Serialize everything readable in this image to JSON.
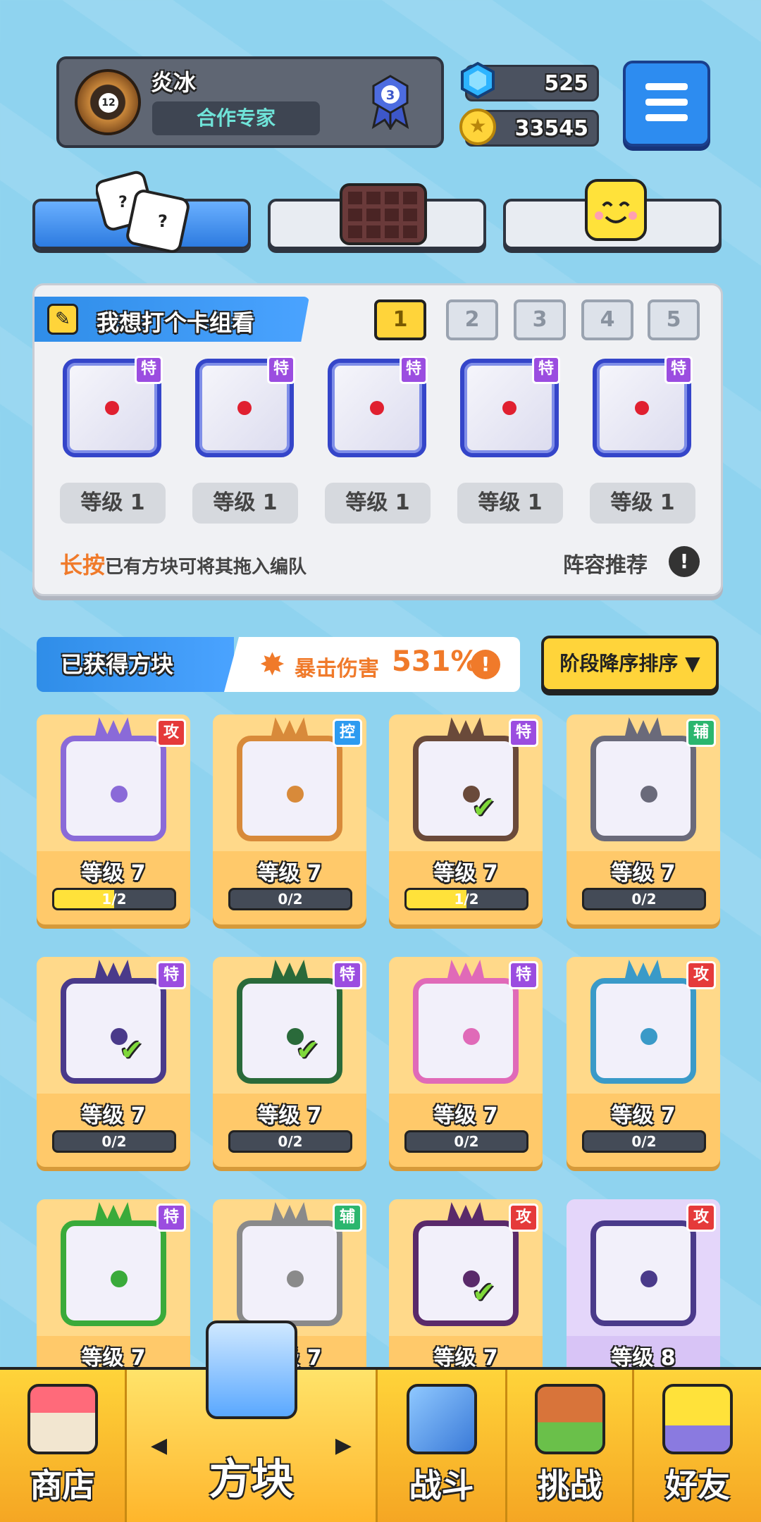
{
  "player": {
    "name": "炎冰",
    "title": "合作专家",
    "avatar_level": "12",
    "rank": "3"
  },
  "currency": {
    "gems": "525",
    "coins": "33545"
  },
  "deck": {
    "title": "我想打个卡组看",
    "numbers": [
      "1",
      "2",
      "3",
      "4",
      "5"
    ],
    "active_index": 0,
    "slots": [
      {
        "tag": "特",
        "level": "等级 1"
      },
      {
        "tag": "特",
        "level": "等级 1"
      },
      {
        "tag": "特",
        "level": "等级 1"
      },
      {
        "tag": "特",
        "level": "等级 1"
      },
      {
        "tag": "特",
        "level": "等级 1"
      }
    ],
    "hint_emph": "长按",
    "hint_rest": "已有方块可将其拖入编队",
    "recommend": "阵容推荐",
    "recommend_icon": "!"
  },
  "collection": {
    "title": "已获得方块",
    "crit_label": "暴击伤害",
    "crit_value": "531%",
    "crit_icon": "!",
    "sort_label": "阶段降序排序 ▼",
    "cards": [
      {
        "tag": "攻",
        "tag_type": "gong",
        "level": "等级 7",
        "progress": "1/2",
        "fill": 0.5,
        "color": "#8a6ad8",
        "checked": false
      },
      {
        "tag": "控",
        "tag_type": "kong",
        "level": "等级 7",
        "progress": "0/2",
        "fill": 0,
        "color": "#d88a3a",
        "checked": false
      },
      {
        "tag": "特",
        "tag_type": "te",
        "level": "等级 7",
        "progress": "1/2",
        "fill": 0.5,
        "color": "#6a4a3a",
        "checked": true
      },
      {
        "tag": "辅",
        "tag_type": "fu",
        "level": "等级 7",
        "progress": "0/2",
        "fill": 0,
        "color": "#6a6a7a",
        "checked": false
      },
      {
        "tag": "特",
        "tag_type": "te",
        "level": "等级 7",
        "progress": "0/2",
        "fill": 0,
        "color": "#4a3a8a",
        "checked": true
      },
      {
        "tag": "特",
        "tag_type": "te",
        "level": "等级 7",
        "progress": "0/2",
        "fill": 0,
        "color": "#2a6a3a",
        "checked": true
      },
      {
        "tag": "特",
        "tag_type": "te",
        "level": "等级 7",
        "progress": "0/2",
        "fill": 0,
        "color": "#e06ab8",
        "checked": false
      },
      {
        "tag": "攻",
        "tag_type": "gong",
        "level": "等级 7",
        "progress": "0/2",
        "fill": 0,
        "color": "#3a9ac8",
        "checked": false
      },
      {
        "tag": "特",
        "tag_type": "te",
        "level": "等级 7",
        "color": "#3aaa3a",
        "checked": false
      },
      {
        "tag": "辅",
        "tag_type": "fu",
        "level": "等级 7",
        "color": "#8a8a8a",
        "checked": false
      },
      {
        "tag": "攻",
        "tag_type": "gong",
        "level": "等级 7",
        "color": "#5a2a6a",
        "checked": true
      },
      {
        "tag": "攻",
        "tag_type": "gong",
        "level": "等级 8",
        "color": "#4a3a8a",
        "checked": false,
        "special": true
      }
    ]
  },
  "nav": {
    "shop": "商店",
    "blocks": "方块",
    "battle": "战斗",
    "challenge": "挑战",
    "friends": "好友",
    "arrow_left": "◀",
    "arrow_right": "▶"
  },
  "colors": {
    "accent_blue": "#2d8cf0",
    "accent_yellow": "#ffd43a",
    "crit_orange": "#f07a2a"
  }
}
